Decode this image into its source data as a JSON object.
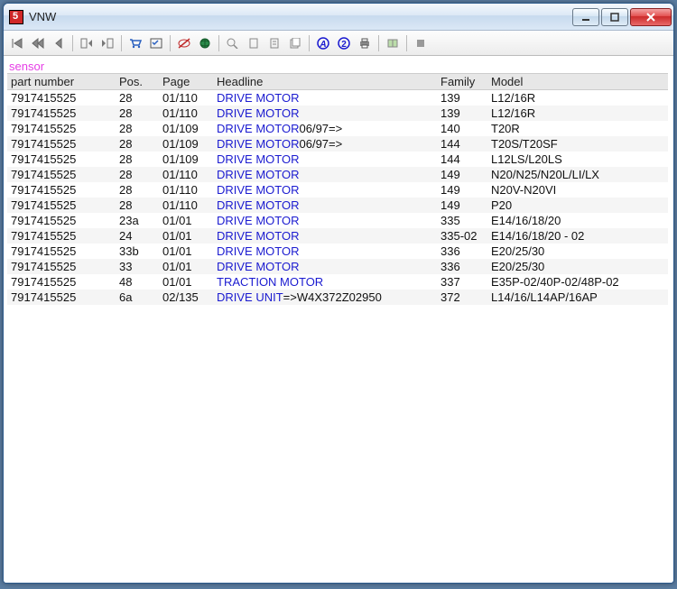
{
  "window": {
    "title": "VNW"
  },
  "filter_text": "sensor",
  "columns": {
    "part": "part number",
    "pos": "Pos.",
    "page": "Page",
    "headline": "Headline",
    "family": "Family",
    "model": "Model"
  },
  "icons": {
    "first": "first-icon",
    "prevset": "prev-set-icon",
    "prev": "prev-icon",
    "bmprev": "bookmark-prev-icon",
    "bmnext": "bookmark-next-icon",
    "cart": "cart-icon",
    "check": "checklist-icon",
    "eye": "eye-off-icon",
    "globe": "globe-icon",
    "zoom": "zoom-icon",
    "page1": "page-icon",
    "page2": "page2-icon",
    "page3": "page3-icon",
    "a1": "letter-a-icon",
    "a2": "letter-2-icon",
    "print": "print-icon",
    "book": "book-icon",
    "stop": "stop-icon"
  },
  "rows": [
    {
      "part": "7917415525",
      "pos": "28",
      "page": "01/110",
      "head_link": "DRIVE MOTOR",
      "head_suffix": "",
      "family": "139",
      "model": "L12/16R"
    },
    {
      "part": "7917415525",
      "pos": "28",
      "page": "01/110",
      "head_link": "DRIVE MOTOR",
      "head_suffix": "",
      "family": "139",
      "model": "L12/16R"
    },
    {
      "part": "7917415525",
      "pos": "28",
      "page": "01/109",
      "head_link": "DRIVE MOTOR",
      "head_suffix": "06/97=>",
      "family": "140",
      "model": "T20R"
    },
    {
      "part": "7917415525",
      "pos": "28",
      "page": "01/109",
      "head_link": "DRIVE MOTOR",
      "head_suffix": "06/97=>",
      "family": "144",
      "model": "T20S/T20SF"
    },
    {
      "part": "7917415525",
      "pos": "28",
      "page": "01/109",
      "head_link": "DRIVE MOTOR",
      "head_suffix": "",
      "family": "144",
      "model": "L12LS/L20LS"
    },
    {
      "part": "7917415525",
      "pos": "28",
      "page": "01/110",
      "head_link": "DRIVE MOTOR",
      "head_suffix": "",
      "family": "149",
      "model": "N20/N25/N20L/LI/LX"
    },
    {
      "part": "7917415525",
      "pos": "28",
      "page": "01/110",
      "head_link": "DRIVE MOTOR",
      "head_suffix": "",
      "family": "149",
      "model": "N20V-N20VI"
    },
    {
      "part": "7917415525",
      "pos": "28",
      "page": "01/110",
      "head_link": "DRIVE MOTOR",
      "head_suffix": "",
      "family": "149",
      "model": "P20"
    },
    {
      "part": "7917415525",
      "pos": "23a",
      "page": "01/01",
      "head_link": "DRIVE MOTOR",
      "head_suffix": "",
      "family": "335",
      "model": "E14/16/18/20"
    },
    {
      "part": "7917415525",
      "pos": "24",
      "page": "01/01",
      "head_link": "DRIVE MOTOR",
      "head_suffix": "",
      "family": "335-02",
      "model": "E14/16/18/20 - 02"
    },
    {
      "part": "7917415525",
      "pos": "33b",
      "page": "01/01",
      "head_link": "DRIVE MOTOR",
      "head_suffix": "",
      "family": "336",
      "model": "E20/25/30"
    },
    {
      "part": "7917415525",
      "pos": "33",
      "page": "01/01",
      "head_link": "DRIVE MOTOR",
      "head_suffix": "",
      "family": "336",
      "model": "E20/25/30"
    },
    {
      "part": "7917415525",
      "pos": "48",
      "page": "01/01",
      "head_link": "TRACTION MOTOR",
      "head_suffix": "",
      "family": "337",
      "model": "E35P-02/40P-02/48P-02"
    },
    {
      "part": "7917415525",
      "pos": "6a",
      "page": "02/135",
      "head_link": "DRIVE UNIT",
      "head_suffix": "=>W4X372Z02950",
      "family": "372",
      "model": "L14/16/L14AP/16AP"
    }
  ]
}
